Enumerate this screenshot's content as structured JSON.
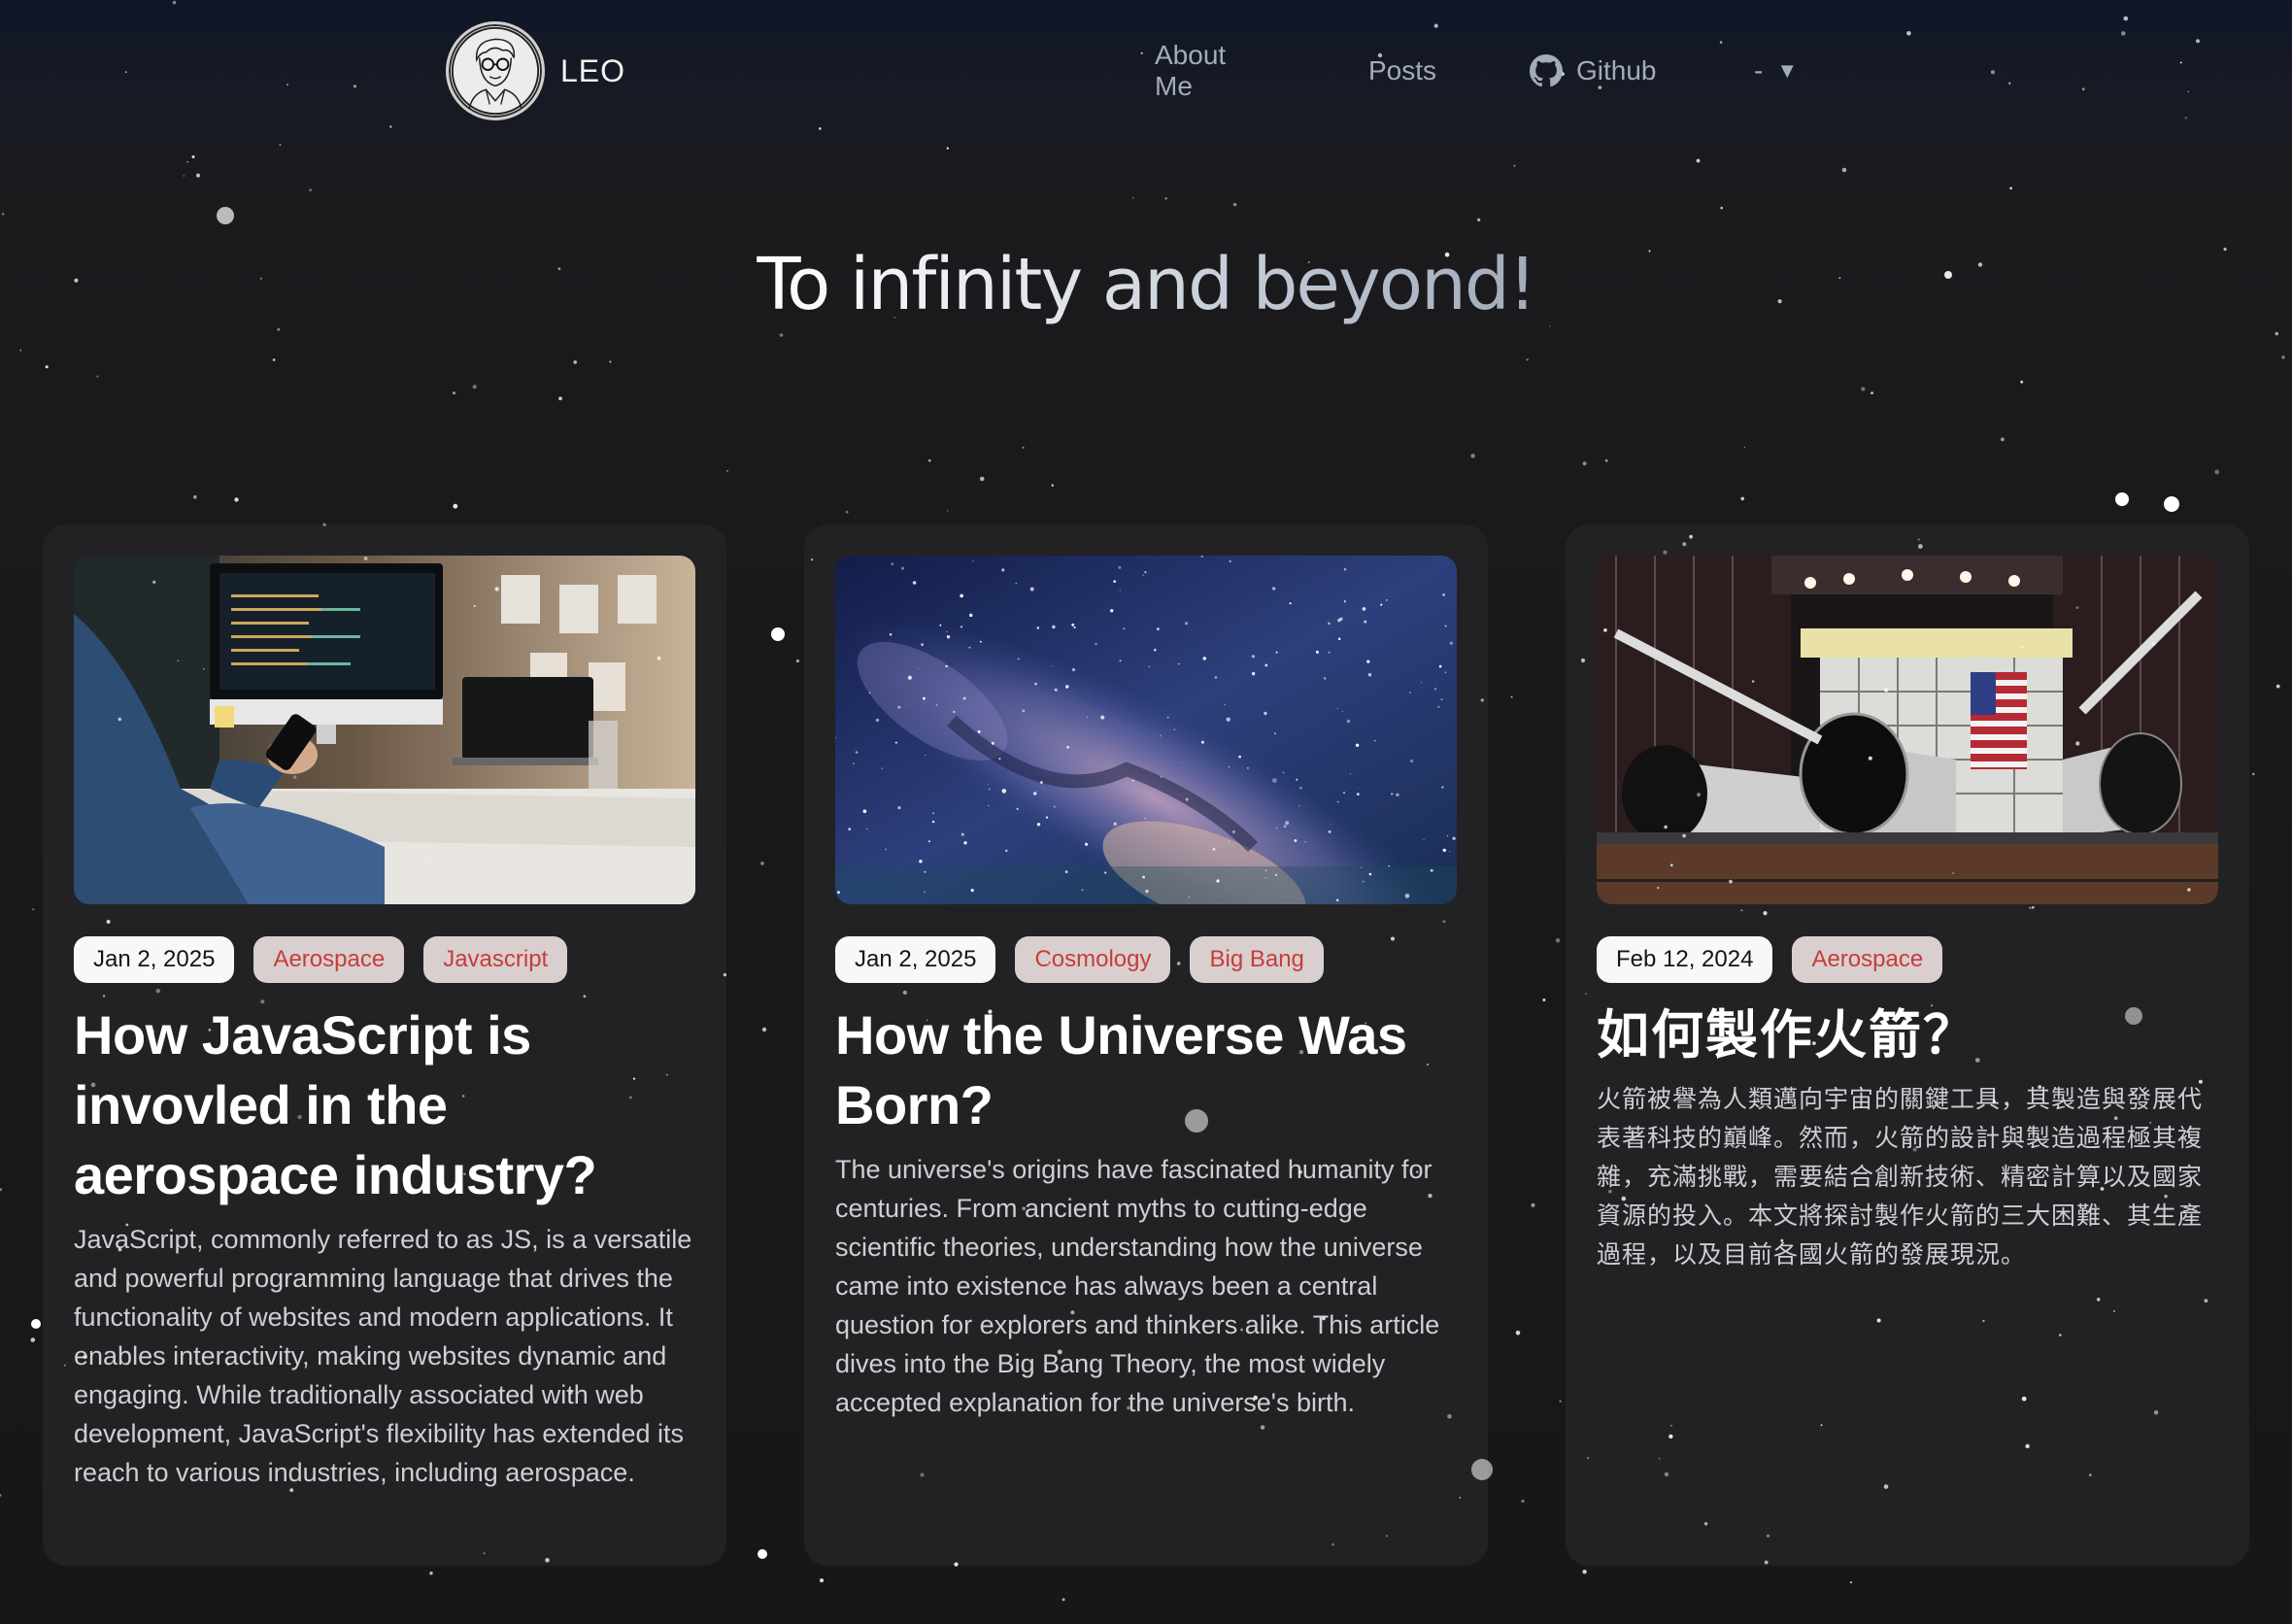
{
  "header": {
    "brand_name": "LEO",
    "avatar_alt": "sketch portrait avatar",
    "nav": {
      "about_label": "About Me",
      "posts_label": "Posts",
      "github_label": "Github",
      "github_icon": "github-icon"
    },
    "language_select": {
      "selected": "-",
      "caret_icon": "▼"
    }
  },
  "hero": {
    "title": "To infinity and beyond!"
  },
  "posts": [
    {
      "image_subject": "person holding phone at desk with code on monitor",
      "date": "Jan 2, 2025",
      "tags": [
        "Aerospace",
        "Javascript"
      ],
      "title": "How JavaScript is invovled in the aerospace industry?",
      "excerpt": "JavaScript, commonly referred to as JS, is a versatile and powerful programming language that drives the functionality of websites and modern applications. It enables interactivity, making websites dynamic and engaging. While traditionally associated with web development, JavaScript's flexibility has extended its reach to various industries, including aerospace."
    },
    {
      "image_subject": "milky way night sky",
      "date": "Jan 2, 2025",
      "tags": [
        "Cosmology",
        "Big Bang"
      ],
      "title": "How the Universe Was Born?",
      "excerpt": "The universe's origins have fascinated humanity for centuries. From ancient myths to cutting-edge scientific theories, understanding how the universe came into existence has always been a central question for explorers and thinkers alike. This article dives into the Big Bang Theory, the most widely accepted explanation for the universe's birth."
    },
    {
      "image_subject": "rocket boosters in hangar with american flag",
      "date": "Feb 12, 2024",
      "tags": [
        "Aerospace"
      ],
      "title": "如何製作火箭？",
      "excerpt": "火箭被譽為人類邁向宇宙的關鍵工具，其製造與發展代表著科技的巔峰。然而，火箭的設計與製造過程極其複雜，充滿挑戰，需要結合創新技術、精密計算以及國家資源的投入。本文將探討製作火箭的三大困難、其生產過程，以及目前各國火箭的發展現況。"
    }
  ],
  "colors": {
    "page_bg": "#18181a",
    "card_bg": "#222225",
    "nav_text": "#a4abba",
    "tag_date_bg": "#f8f8f8",
    "tag_topic_bg": "#d9cfcf",
    "tag_topic_text": "#c73d38"
  }
}
